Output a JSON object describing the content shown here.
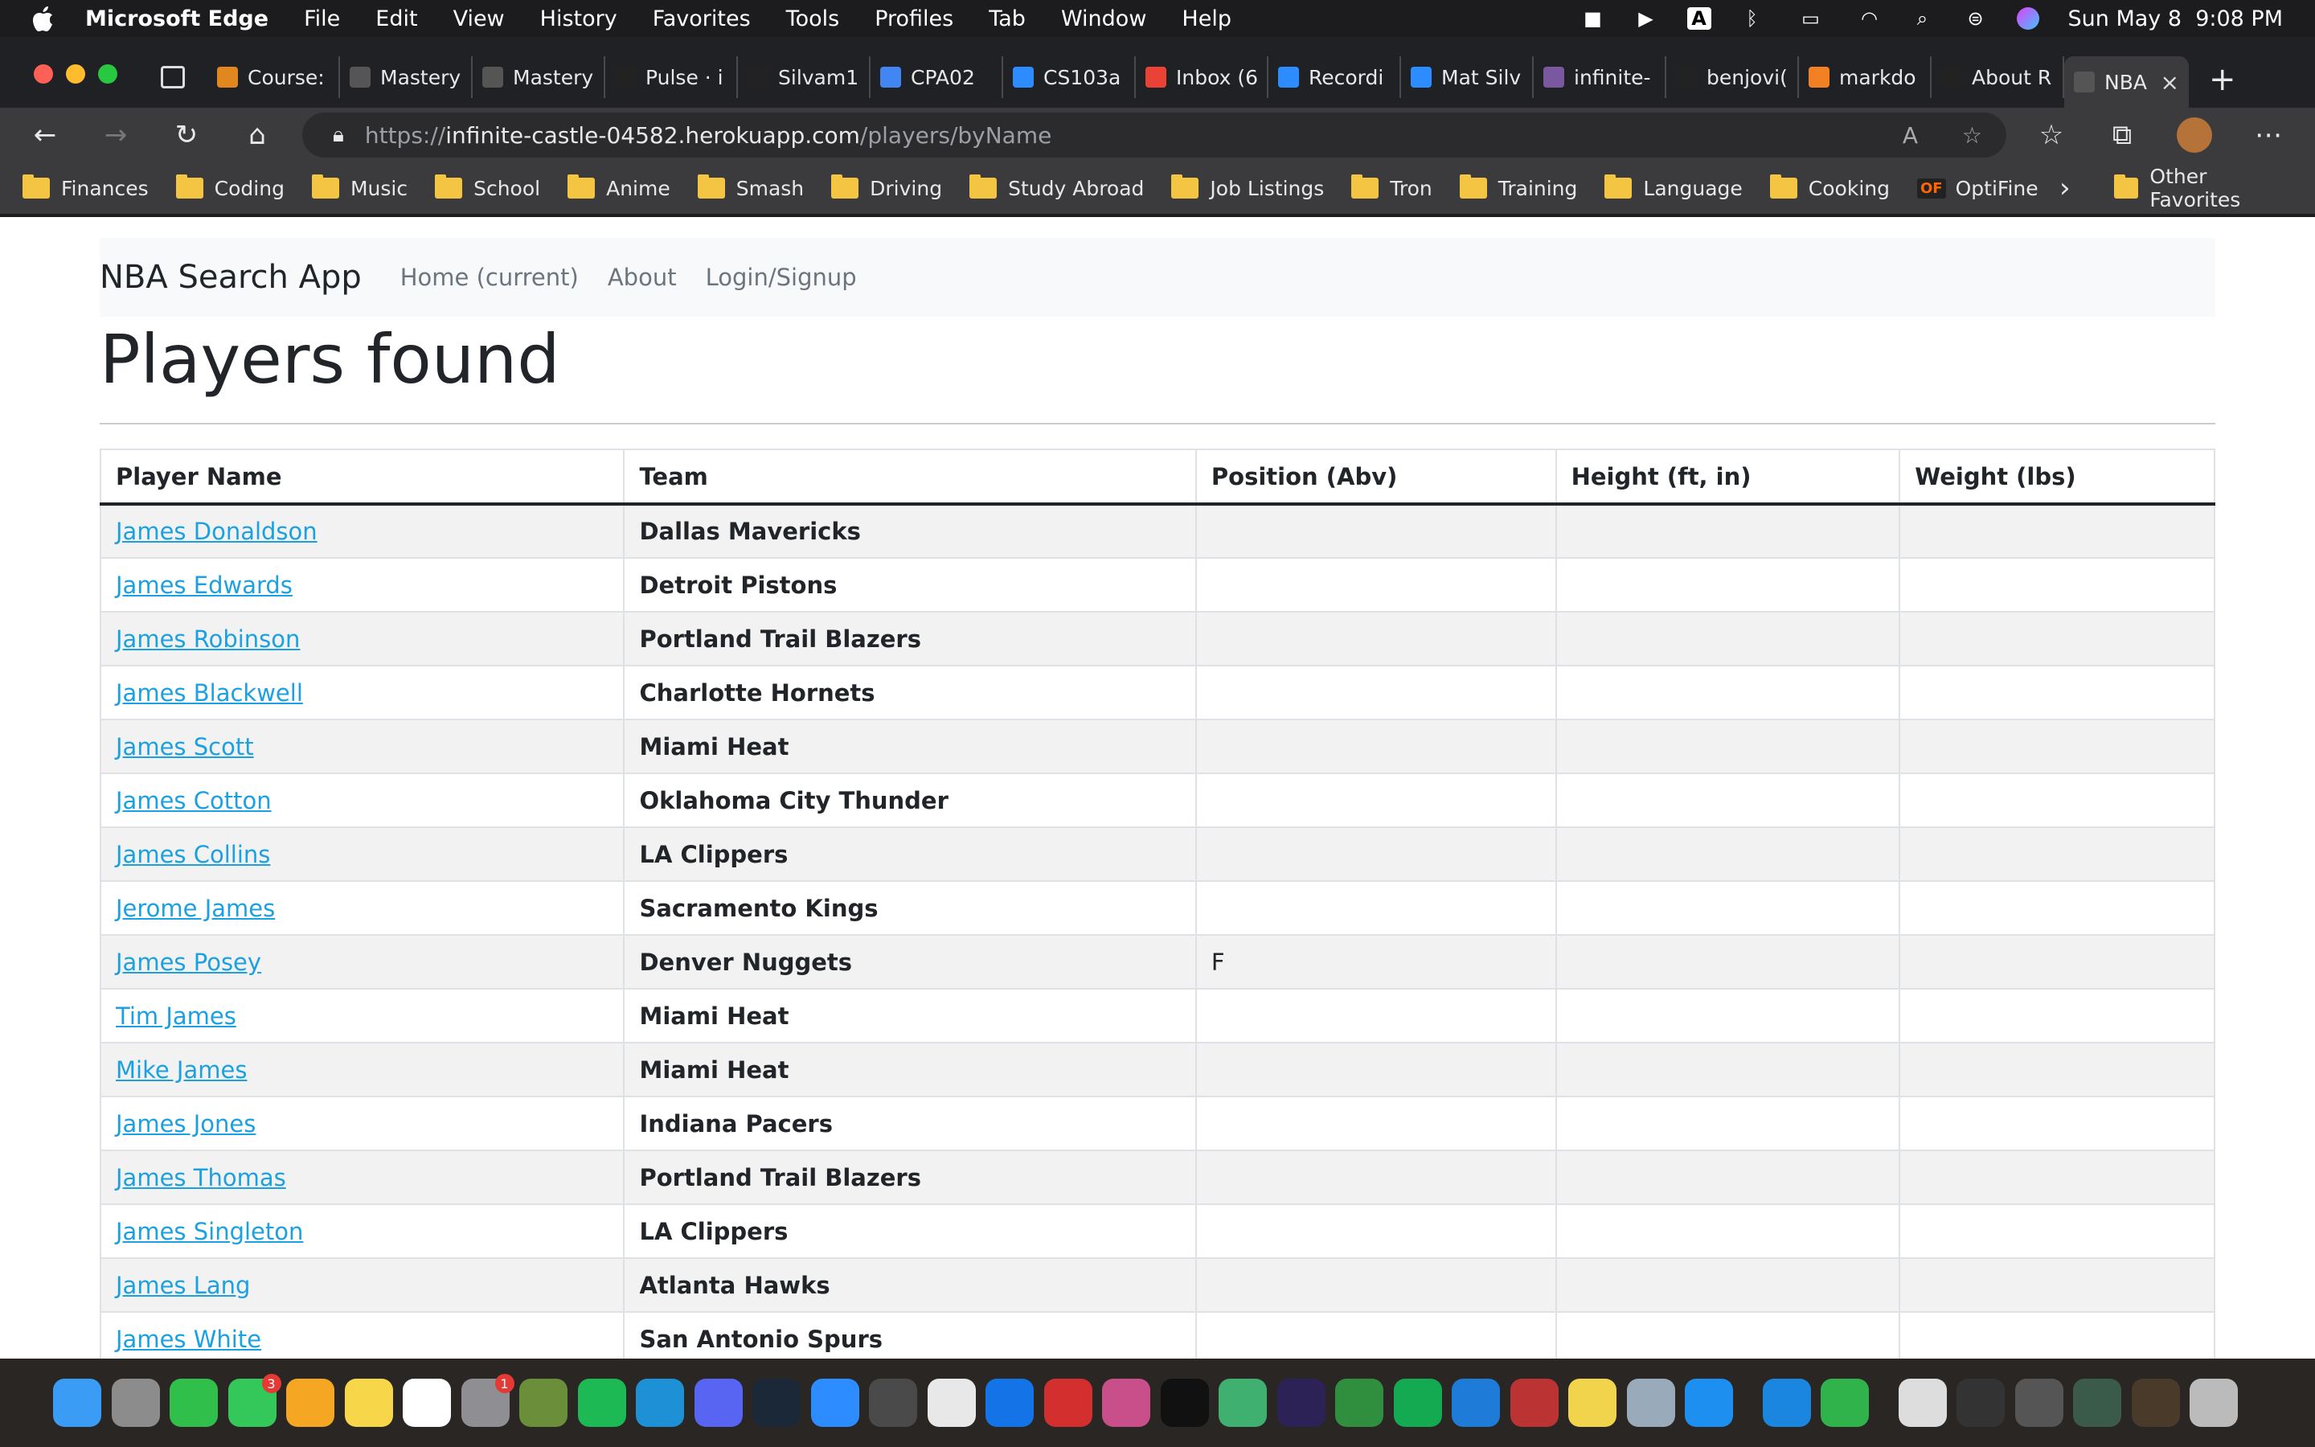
{
  "menubar": {
    "app": "Microsoft Edge",
    "items": [
      "File",
      "Edit",
      "View",
      "History",
      "Favorites",
      "Tools",
      "Profiles",
      "Tab",
      "Window",
      "Help"
    ],
    "datetime": "Sun May 8  9:08 PM"
  },
  "tabs": [
    {
      "title": "Course:",
      "icon": "coursera-icon",
      "color": "#e0881f"
    },
    {
      "title": "Mastery",
      "icon": "page-icon",
      "color": "#555"
    },
    {
      "title": "Mastery",
      "icon": "page-icon",
      "color": "#555"
    },
    {
      "title": "Pulse · i",
      "icon": "github-icon",
      "color": "#222"
    },
    {
      "title": "Silvam1",
      "icon": "github-icon",
      "color": "#222"
    },
    {
      "title": "CPA02",
      "icon": "docs-icon",
      "color": "#4285f4"
    },
    {
      "title": "CS103a",
      "icon": "zoom-icon",
      "color": "#2d8cff"
    },
    {
      "title": "Inbox (6",
      "icon": "gmail-icon",
      "color": "#ea4335"
    },
    {
      "title": "Recordi",
      "icon": "zoom-icon",
      "color": "#2d8cff"
    },
    {
      "title": "Mat Silv",
      "icon": "zoom-icon",
      "color": "#2d8cff"
    },
    {
      "title": "infinite-",
      "icon": "heroku-icon",
      "color": "#79589f"
    },
    {
      "title": "benjovi(",
      "icon": "github-icon",
      "color": "#222"
    },
    {
      "title": "markdo",
      "icon": "stackoverflow-icon",
      "color": "#f48024"
    },
    {
      "title": "About R",
      "icon": "github-icon",
      "color": "#222"
    },
    {
      "title": "NBA",
      "icon": "page-icon",
      "color": "#555"
    }
  ],
  "url": {
    "prefix": "https://",
    "host": "infinite-castle-04582.herokuapp.com",
    "path": "/players/byName"
  },
  "bookmarks": [
    "Finances",
    "Coding",
    "Music",
    "School",
    "Anime",
    "Smash",
    "Driving",
    "Study Abroad",
    "Job Listings",
    "Tron",
    "Training",
    "Language",
    "Cooking"
  ],
  "bookmark_optifine": "OptiFine",
  "bookmark_other": "Other Favorites",
  "navbar": {
    "brand": "NBA Search App",
    "links": [
      "Home (current)",
      "About",
      "Login/Signup"
    ]
  },
  "page_title": "Players found",
  "table": {
    "headers": [
      "Player Name",
      "Team",
      "Position (Abv)",
      "Height (ft, in)",
      "Weight (lbs)"
    ],
    "rows": [
      {
        "name": "James Donaldson",
        "team": "Dallas Mavericks",
        "pos": ""
      },
      {
        "name": "James Edwards",
        "team": "Detroit Pistons",
        "pos": ""
      },
      {
        "name": "James Robinson",
        "team": "Portland Trail Blazers",
        "pos": ""
      },
      {
        "name": "James Blackwell",
        "team": "Charlotte Hornets",
        "pos": ""
      },
      {
        "name": "James Scott",
        "team": "Miami Heat",
        "pos": ""
      },
      {
        "name": "James Cotton",
        "team": "Oklahoma City Thunder",
        "pos": ""
      },
      {
        "name": "James Collins",
        "team": "LA Clippers",
        "pos": ""
      },
      {
        "name": "Jerome James",
        "team": "Sacramento Kings",
        "pos": ""
      },
      {
        "name": "James Posey",
        "team": "Denver Nuggets",
        "pos": "F"
      },
      {
        "name": "Tim James",
        "team": "Miami Heat",
        "pos": ""
      },
      {
        "name": "Mike James",
        "team": "Miami Heat",
        "pos": ""
      },
      {
        "name": "James Jones",
        "team": "Indiana Pacers",
        "pos": ""
      },
      {
        "name": "James Thomas",
        "team": "Portland Trail Blazers",
        "pos": ""
      },
      {
        "name": "James Singleton",
        "team": "LA Clippers",
        "pos": ""
      },
      {
        "name": "James Lang",
        "team": "Atlanta Hawks",
        "pos": ""
      },
      {
        "name": "James White",
        "team": "San Antonio Spurs",
        "pos": ""
      }
    ]
  },
  "dock": {
    "apps": [
      {
        "name": "finder",
        "color": "#3b9cf5"
      },
      {
        "name": "launchpad",
        "color": "#8c8c8c"
      },
      {
        "name": "facetime",
        "color": "#2fbf4a"
      },
      {
        "name": "messages",
        "color": "#34c759",
        "badge": "3"
      },
      {
        "name": "photos",
        "color": "#f5a623"
      },
      {
        "name": "notes",
        "color": "#f7d64a"
      },
      {
        "name": "calendar",
        "color": "#ffffff"
      },
      {
        "name": "system-preferences",
        "color": "#8e8e93",
        "badge": "1"
      },
      {
        "name": "minecraft",
        "color": "#6b8e3a"
      },
      {
        "name": "spotify",
        "color": "#1db954"
      },
      {
        "name": "edge",
        "color": "#1e90d6"
      },
      {
        "name": "discord",
        "color": "#5865f2"
      },
      {
        "name": "steam",
        "color": "#1b2838"
      },
      {
        "name": "zoom",
        "color": "#2d8cff"
      },
      {
        "name": "quicktime",
        "color": "#4a4a4a"
      },
      {
        "name": "textedit",
        "color": "#e8e8e8"
      },
      {
        "name": "adobe",
        "color": "#1473e6"
      },
      {
        "name": "acrobat",
        "color": "#d32f2f"
      },
      {
        "name": "chrome-canary",
        "color": "#c94f8a"
      },
      {
        "name": "terminal",
        "color": "#111"
      },
      {
        "name": "atom",
        "color": "#40b070"
      },
      {
        "name": "eclipse",
        "color": "#2c2255"
      },
      {
        "name": "obs",
        "color": "#2f8f3f"
      },
      {
        "name": "mongodb",
        "color": "#13aa52"
      },
      {
        "name": "vscode",
        "color": "#1f7bd8"
      },
      {
        "name": "racket",
        "color": "#b33"
      },
      {
        "name": "python",
        "color": "#f2d34c"
      },
      {
        "name": "preview",
        "color": "#9ab"
      },
      {
        "name": "app-store",
        "color": "#1d8ff0"
      },
      {
        "name": "keynote",
        "color": "#1a86e0"
      },
      {
        "name": "numbers",
        "color": "#2fb34a"
      },
      {
        "name": "document",
        "color": "#ddd"
      },
      {
        "name": "screenshot-1",
        "color": "#333"
      },
      {
        "name": "screenshot-2",
        "color": "#555"
      },
      {
        "name": "screenshot-3",
        "color": "#3a5a4a"
      },
      {
        "name": "screenshot-4",
        "color": "#4a3a2a"
      },
      {
        "name": "trash",
        "color": "#bbb"
      }
    ]
  }
}
